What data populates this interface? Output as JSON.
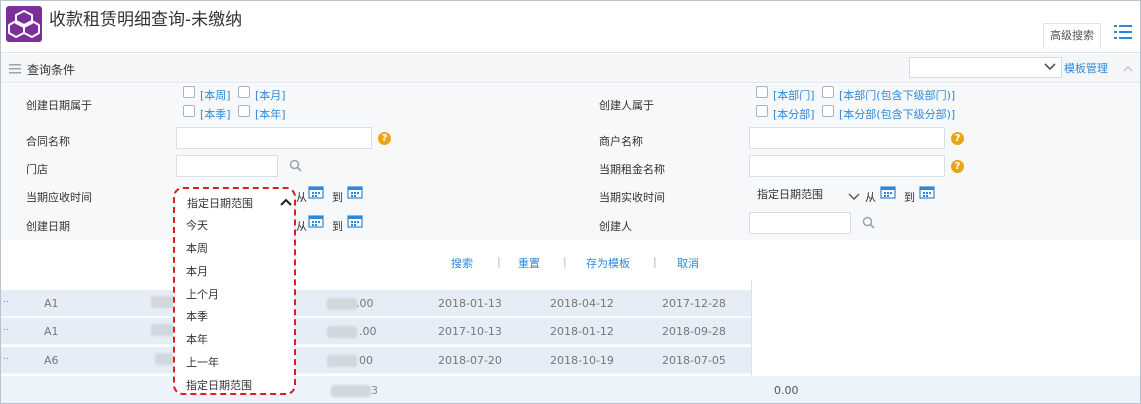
{
  "header": {
    "title": "收款租赁明细查询-未缴纳",
    "advanced_search": "高级搜索",
    "logo_icon": "cubes-icon",
    "list_icon": "list-icon"
  },
  "query_bar": {
    "title": "查询条件",
    "template_manage": "模板管理"
  },
  "form": {
    "created_date_label": "创建日期属于",
    "created_date_options": [
      "[本周]",
      "[本月]",
      "[本季]",
      "[本年]"
    ],
    "creator_belongs_label": "创建人属于",
    "creator_belongs_options": [
      "[本部门]",
      "[本部门(包含下级部门)]",
      "[本分部]",
      "[本分部(包含下级分部)]"
    ],
    "contract_name_label": "合同名称",
    "merchant_name_label": "商户名称",
    "store_label": "门店",
    "rent_name_label": "当期租金名称",
    "receivable_time_label": "当期应收时间",
    "from_text": "从",
    "to_text": "到",
    "actual_receipt_label": "当期实收时间",
    "actual_receipt_value": "指定日期范围",
    "create_date_label": "创建日期",
    "creator_label": "创建人"
  },
  "actions": {
    "search": "搜索",
    "reset": "重置",
    "save_template": "存为模板",
    "cancel": "取消"
  },
  "dropdown": {
    "current": "指定日期范围",
    "options": [
      "今天",
      "本周",
      "本月",
      "上个月",
      "本季",
      "本年",
      "上一年",
      "指定日期范围"
    ]
  },
  "table": {
    "rows": [
      {
        "code": "A1",
        "amount": ".00",
        "d1": "2018-01-13",
        "d2": "2018-04-12",
        "d3": "2017-12-28"
      },
      {
        "code": "A1",
        "amount": ".00",
        "d1": "2017-10-13",
        "d2": "2018-01-12",
        "d3": "2018-09-28"
      },
      {
        "code": "A6",
        "amount": "00",
        "d1": "2018-07-20",
        "d2": "2018-10-19",
        "d3": "2018-07-05"
      }
    ],
    "total_partial": "3",
    "total_value": "0.00"
  },
  "colors": {
    "link": "#2f89d9",
    "logo": "#7b2f9a",
    "highlight_border": "#d91f1f",
    "help": "#e8a615"
  }
}
